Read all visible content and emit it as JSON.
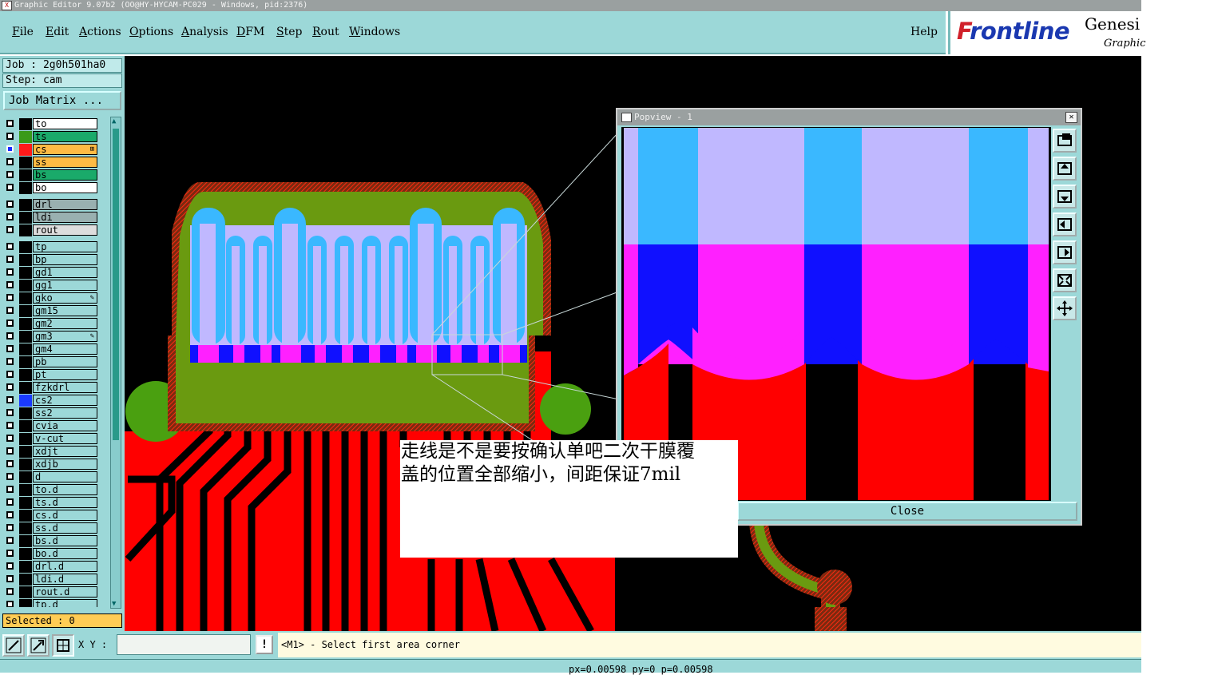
{
  "window": {
    "title": "Graphic Editor 9.07b2 (OO@HY-HYCAM-PC029 - Windows, pid:2376)",
    "title_icon": "x-window-icon"
  },
  "menu": {
    "items": [
      {
        "key": "F",
        "rest": "ile"
      },
      {
        "key": "E",
        "rest": "dit"
      },
      {
        "key": "A",
        "rest": "ctions"
      },
      {
        "key": "O",
        "rest": "ptions"
      },
      {
        "key": "A",
        "rest": "nalysis"
      },
      {
        "key": "D",
        "rest": "FM"
      },
      {
        "key": "S",
        "rest": "tep"
      },
      {
        "key": "R",
        "rest": "out"
      },
      {
        "key": "W",
        "rest": "indows"
      }
    ],
    "help": "Help"
  },
  "logo": {
    "brand_first": "F",
    "brand_rest": "rontline",
    "product": "Genesi",
    "subtitle": "Graphic"
  },
  "job": {
    "job_line": "Job : 2g0h501ha0",
    "step_line": "Step: cam",
    "matrix_button": "Job Matrix ..."
  },
  "layers": [
    {
      "name": "to",
      "swatch": "#000000",
      "bg": "#ffffff",
      "checked": false,
      "mark": ""
    },
    {
      "name": "ts",
      "swatch": "#3a9a1a",
      "bg": "#1aaa6a",
      "checked": false,
      "mark": ""
    },
    {
      "name": "cs",
      "swatch": "#ff1a1a",
      "bg": "#ffbb44",
      "checked": true,
      "mark": "⊞"
    },
    {
      "name": "ss",
      "swatch": "#000000",
      "bg": "#ffbb44",
      "checked": false,
      "mark": ""
    },
    {
      "name": "bs",
      "swatch": "#000000",
      "bg": "#1aaa6a",
      "checked": false,
      "mark": ""
    },
    {
      "name": "bo",
      "swatch": "#000000",
      "bg": "#ffffff",
      "checked": false,
      "mark": ""
    },
    {
      "name": "drl",
      "swatch": "#000000",
      "bg": "#99b0b0",
      "checked": false,
      "mark": ""
    },
    {
      "name": "ldi",
      "swatch": "#000000",
      "bg": "#99b0b0",
      "checked": false,
      "mark": ""
    },
    {
      "name": "rout",
      "swatch": "#000000",
      "bg": "#dddddd",
      "checked": false,
      "mark": ""
    },
    {
      "name": "tp",
      "swatch": "#000000",
      "bg": "#9cd8d8",
      "checked": false,
      "mark": ""
    },
    {
      "name": "bp",
      "swatch": "#000000",
      "bg": "#9cd8d8",
      "checked": false,
      "mark": ""
    },
    {
      "name": "gd1",
      "swatch": "#000000",
      "bg": "#9cd8d8",
      "checked": false,
      "mark": ""
    },
    {
      "name": "gg1",
      "swatch": "#000000",
      "bg": "#9cd8d8",
      "checked": false,
      "mark": ""
    },
    {
      "name": "gko",
      "swatch": "#000000",
      "bg": "#9cd8d8",
      "checked": false,
      "mark": "✎"
    },
    {
      "name": "gm15",
      "swatch": "#000000",
      "bg": "#9cd8d8",
      "checked": false,
      "mark": ""
    },
    {
      "name": "gm2",
      "swatch": "#000000",
      "bg": "#9cd8d8",
      "checked": false,
      "mark": ""
    },
    {
      "name": "gm3",
      "swatch": "#000000",
      "bg": "#9cd8d8",
      "checked": false,
      "mark": "✎"
    },
    {
      "name": "gm4",
      "swatch": "#000000",
      "bg": "#9cd8d8",
      "checked": false,
      "mark": ""
    },
    {
      "name": "pb",
      "swatch": "#000000",
      "bg": "#9cd8d8",
      "checked": false,
      "mark": ""
    },
    {
      "name": "pt",
      "swatch": "#000000",
      "bg": "#9cd8d8",
      "checked": false,
      "mark": ""
    },
    {
      "name": "fzkdrl",
      "swatch": "#000000",
      "bg": "#9cd8d8",
      "checked": false,
      "mark": ""
    },
    {
      "name": "cs2",
      "swatch": "#1a3aff",
      "bg": "#9cd8d8",
      "checked": false,
      "mark": ""
    },
    {
      "name": "ss2",
      "swatch": "#000000",
      "bg": "#9cd8d8",
      "checked": false,
      "mark": ""
    },
    {
      "name": "cvia",
      "swatch": "#000000",
      "bg": "#9cd8d8",
      "checked": false,
      "mark": ""
    },
    {
      "name": "v-cut",
      "swatch": "#000000",
      "bg": "#9cd8d8",
      "checked": false,
      "mark": ""
    },
    {
      "name": "xdjt",
      "swatch": "#000000",
      "bg": "#9cd8d8",
      "checked": false,
      "mark": ""
    },
    {
      "name": "xdjb",
      "swatch": "#000000",
      "bg": "#9cd8d8",
      "checked": false,
      "mark": ""
    },
    {
      "name": "d",
      "swatch": "#000000",
      "bg": "#9cd8d8",
      "checked": false,
      "mark": ""
    },
    {
      "name": "to.d",
      "swatch": "#000000",
      "bg": "#9cd8d8",
      "checked": false,
      "mark": ""
    },
    {
      "name": "ts.d",
      "swatch": "#000000",
      "bg": "#9cd8d8",
      "checked": false,
      "mark": ""
    },
    {
      "name": "cs.d",
      "swatch": "#000000",
      "bg": "#9cd8d8",
      "checked": false,
      "mark": ""
    },
    {
      "name": "ss.d",
      "swatch": "#000000",
      "bg": "#9cd8d8",
      "checked": false,
      "mark": ""
    },
    {
      "name": "bs.d",
      "swatch": "#000000",
      "bg": "#9cd8d8",
      "checked": false,
      "mark": ""
    },
    {
      "name": "bo.d",
      "swatch": "#000000",
      "bg": "#9cd8d8",
      "checked": false,
      "mark": ""
    },
    {
      "name": "drl.d",
      "swatch": "#000000",
      "bg": "#9cd8d8",
      "checked": false,
      "mark": ""
    },
    {
      "name": "ldi.d",
      "swatch": "#000000",
      "bg": "#9cd8d8",
      "checked": false,
      "mark": ""
    },
    {
      "name": "rout.d",
      "swatch": "#000000",
      "bg": "#9cd8d8",
      "checked": false,
      "mark": ""
    },
    {
      "name": "tp.d",
      "swatch": "#000000",
      "bg": "#9cd8d8",
      "checked": false,
      "mark": ""
    }
  ],
  "selected_text": "Selected : 0",
  "popview": {
    "title": "Popview - 1",
    "close_x": "✕",
    "close_label": "Close",
    "tool_icons": [
      "popview-zoom-icon",
      "popview-up-icon",
      "popview-down-icon",
      "popview-left-icon",
      "popview-right-icon",
      "popview-fit-icon",
      "popview-center-icon"
    ]
  },
  "note": {
    "line1": "走线是不是要按确认单吧二次干膜覆",
    "line2": "盖的位置全部缩小，间距保证7mil"
  },
  "bottom": {
    "xy_label": "X Y :",
    "xy_value": "",
    "excl": "!",
    "message": "<M1> - Select first area corner",
    "coords": "px=0.00598 py=0 p=0.00598"
  },
  "colors": {
    "panel": "#9cd8d8",
    "copper_red": "#ff0000",
    "mask_green": "#5a9a10",
    "lavender": "#c0b8ff",
    "cyan": "#3ab8ff",
    "magenta": "#ff20ff",
    "blue": "#1010ff"
  }
}
